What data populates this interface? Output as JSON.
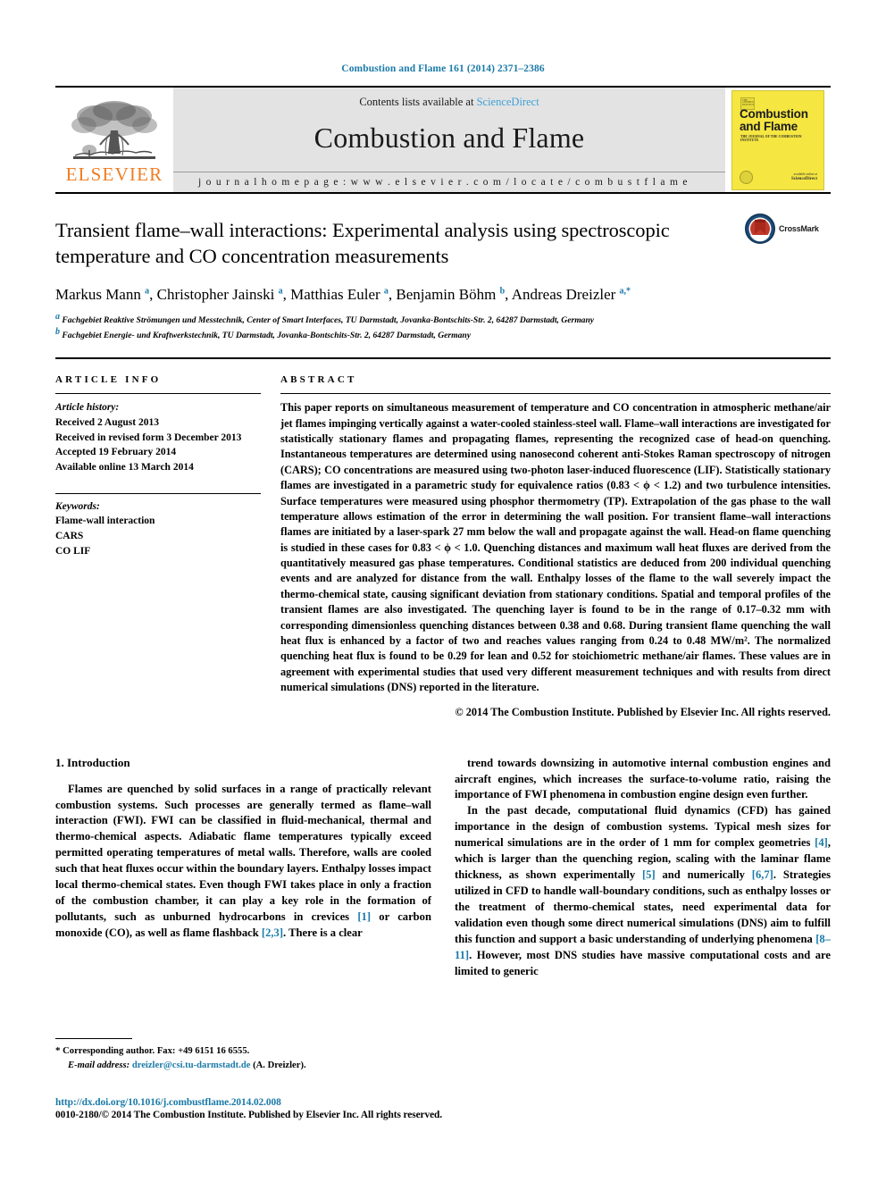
{
  "running_head": "Combustion and Flame 161 (2014) 2371–2386",
  "masthead": {
    "publisher_name": "ELSEVIER",
    "contents_prefix": "Contents lists available at ",
    "sciencedirect": "ScienceDirect",
    "journal_title": "Combustion and Flame",
    "homepage": "j o u r n a l   h o m e p a g e :   w w w . e l s e v i e r . c o m / l o c a t e / c o m b u s t f l a m e",
    "cover": {
      "title_line1": "Combustion",
      "title_line2": "and Flame",
      "subtitle": "THE JOURNAL OF THE COMBUSTION INSTITUTE",
      "logo_text": "THE COMBUSTION INSTITUTE",
      "publisher_small": "available online at",
      "publisher": "ScienceDirect"
    }
  },
  "article": {
    "title": "Transient flame–wall interactions: Experimental analysis using spectroscopic temperature and CO concentration measurements",
    "crossmark_label": "CrossMark",
    "authors_html": "Markus Mann <sup>a</sup>, Christopher Jainski <sup>a</sup>, Matthias Euler <sup>a</sup>, Benjamin Böhm <sup>b</sup>, Andreas Dreizler <sup>a,<span class=\"star\">*</span></sup>",
    "affiliation_a": "Fachgebiet Reaktive Strömungen und Messtechnik, Center of Smart Interfaces, TU Darmstadt, Jovanka-Bontschits-Str. 2, 64287 Darmstadt, Germany",
    "affiliation_b": "Fachgebiet Energie- und Kraftwerkstechnik, TU Darmstadt, Jovanka-Bontschits-Str. 2, 64287 Darmstadt, Germany"
  },
  "article_info": {
    "heading": "ARTICLE INFO",
    "history_label": "Article history:",
    "history": [
      "Received 2 August 2013",
      "Received in revised form 3 December 2013",
      "Accepted 19 February 2014",
      "Available online 13 March 2014"
    ],
    "keywords_label": "Keywords:",
    "keywords": [
      "Flame-wall interaction",
      "CARS",
      "CO LIF"
    ]
  },
  "abstract": {
    "heading": "ABSTRACT",
    "text": "This paper reports on simultaneous measurement of temperature and CO concentration in atmospheric methane/air jet flames impinging vertically against a water-cooled stainless-steel wall. Flame–wall interactions are investigated for statistically stationary flames and propagating flames, representing the recognized case of head-on quenching. Instantaneous temperatures are determined using nanosecond coherent anti-Stokes Raman spectroscopy of nitrogen (CARS); CO concentrations are measured using two-photon laser-induced fluorescence (LIF). Statistically stationary flames are investigated in a parametric study for equivalence ratios (0.83 < ϕ < 1.2) and two turbulence intensities. Surface temperatures were measured using phosphor thermometry (TP). Extrapolation of the gas phase to the wall temperature allows estimation of the error in determining the wall position. For transient flame–wall interactions flames are initiated by a laser-spark 27 mm below the wall and propagate against the wall. Head-on flame quenching is studied in these cases for 0.83 < ϕ < 1.0. Quenching distances and maximum wall heat fluxes are derived from the quantitatively measured gas phase temperatures. Conditional statistics are deduced from 200 individual quenching events and are analyzed for distance from the wall. Enthalpy losses of the flame to the wall severely impact the thermo-chemical state, causing significant deviation from stationary conditions. Spatial and temporal profiles of the transient flames are also investigated. The quenching layer is found to be in the range of 0.17–0.32 mm with corresponding dimensionless quenching distances between 0.38 and 0.68. During transient flame quenching the wall heat flux is enhanced by a factor of two and reaches values ranging from 0.24 to 0.48 MW/m². The normalized quenching heat flux is found to be 0.29 for lean and 0.52 for stoichiometric methane/air flames. These values are in agreement with experimental studies that used very different measurement techniques and with results from direct numerical simulations (DNS) reported in the literature.",
    "copyright": "© 2014 The Combustion Institute. Published by Elsevier Inc. All rights reserved."
  },
  "introduction": {
    "heading": "1. Introduction",
    "left_paragraph_html": "Flames are quenched by solid surfaces in a range of practically relevant combustion systems. Such processes are generally termed as flame–wall interaction (FWI). FWI can be classified in fluid-mechanical, thermal and thermo-chemical aspects. Adiabatic flame temperatures typically exceed permitted operating temperatures of metal walls. Therefore, walls are cooled such that heat fluxes occur within the boundary layers. Enthalpy losses impact local thermo-chemical states. Even though FWI takes place in only a fraction of the combustion chamber, it can play a key role in the formation of pollutants, such as unburned hydrocarbons in crevices <span class=\"ref\">[1]</span> or carbon monoxide (CO), as well as flame flashback <span class=\"ref\">[2,3]</span>. There is a clear",
    "right_paragraph1_html": "trend towards downsizing in automotive internal combustion engines and aircraft engines, which increases the surface-to-volume ratio, raising the importance of FWI phenomena in combustion engine design even further.",
    "right_paragraph2_html": "In the past decade, computational fluid dynamics (CFD) has gained importance in the design of combustion systems. Typical mesh sizes for numerical simulations are in the order of 1 mm for complex geometries <span class=\"ref\">[4]</span>, which is larger than the quenching region, scaling with the laminar flame thickness, as shown experimentally <span class=\"ref\">[5]</span> and numerically <span class=\"ref\">[6,7]</span>. Strategies utilized in CFD to handle wall-boundary conditions, such as enthalpy losses or the treatment of thermo-chemical states, need experimental data for validation even though some direct numerical simulations (DNS) aim to fulfill this function and support a basic understanding of underlying phenomena <span class=\"ref\">[8–11]</span>. However, most DNS studies have massive computational costs and are limited to generic"
  },
  "footnotes": {
    "corresponding_star": "*",
    "corresponding_text": "Corresponding author. Fax: +49 6151 16 6555.",
    "email_label": "E-mail address:",
    "email": "dreizler@csi.tu-darmstadt.de",
    "email_author": "(A. Dreizler).",
    "doi": "http://dx.doi.org/10.1016/j.combustflame.2014.02.008",
    "issn_line": "0010-2180/© 2014 The Combustion Institute. Published by Elsevier Inc. All rights reserved."
  },
  "colors": {
    "link": "#1a7aa8",
    "elsevier_orange": "#F07D22",
    "sciencedirect_blue": "#3fa0d8",
    "cover_yellow": "#f5e642",
    "masthead_gray": "#e3e3e3"
  }
}
